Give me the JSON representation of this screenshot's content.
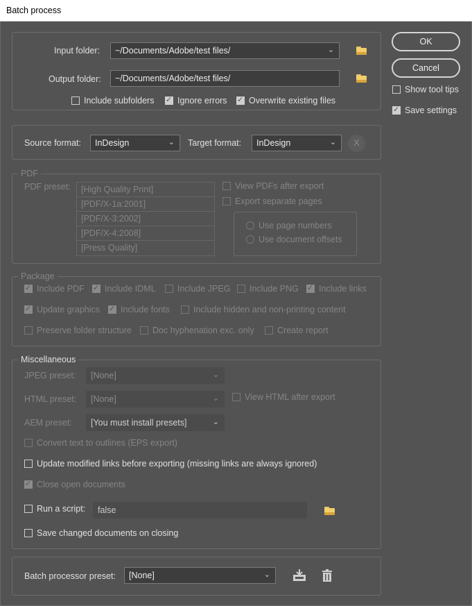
{
  "window": {
    "title": "Batch process"
  },
  "folders": {
    "input_label": "Input folder:",
    "input_value": "~/Documents/Adobe/test files/",
    "output_label": "Output folder:",
    "output_value": "~/Documents/Adobe/test files/",
    "include_subfolders": "Include subfolders",
    "ignore_errors": "Ignore errors",
    "overwrite_existing": "Overwrite existing files"
  },
  "buttons": {
    "ok": "OK",
    "cancel": "Cancel",
    "show_tool_tips": "Show tool tips",
    "save_settings": "Save settings"
  },
  "formats": {
    "source_label": "Source format:",
    "source_value": "InDesign",
    "target_label": "Target format:",
    "target_value": "InDesign",
    "clear": "X"
  },
  "pdf": {
    "legend": "PDF",
    "preset_label": "PDF preset:",
    "presets": [
      "[High Quality Print]",
      "[PDF/X-1a:2001]",
      "[PDF/X-3:2002]",
      "[PDF/X-4:2008]",
      "[Press Quality]"
    ],
    "view_after_export": "View PDFs after export",
    "export_separate_pages": "Export separate pages",
    "use_page_numbers": "Use page numbers",
    "use_document_offsets": "Use document offsets"
  },
  "package": {
    "legend": "Package",
    "include_pdf": "Include PDF",
    "include_idml": "Include IDML",
    "include_jpeg": "Include JPEG",
    "include_png": "Include PNG",
    "include_links": "Include links",
    "update_graphics": "Update graphics",
    "include_fonts": "Include fonts",
    "include_hidden": "Include hidden and non-printing content",
    "preserve_folder_structure": "Preserve folder structure",
    "doc_hyphenation": "Doc hyphenation exc. only",
    "create_report": "Create report"
  },
  "misc": {
    "legend": "Miscellaneous",
    "jpeg_label": "JPEG preset:",
    "jpeg_value": "[None]",
    "html_label": "HTML preset:",
    "html_value": "[None]",
    "view_html": "View HTML after export",
    "aem_label": "AEM preset:",
    "aem_value": "[You must install presets]",
    "convert_text": "Convert text to outlines (EPS export)",
    "update_links": "Update modified links before exporting (missing links are always ignored)",
    "close_docs": "Close open documents",
    "run_script": "Run a script:",
    "script_value": "false",
    "save_changed": "Save changed documents on closing"
  },
  "batch": {
    "preset_label": "Batch processor preset:",
    "preset_value": "[None]"
  },
  "colors": {
    "background": "#535353",
    "border": "#6c6c6c",
    "checkbox": "#cfcfcf",
    "folder_icon": "#f2cf6b"
  }
}
